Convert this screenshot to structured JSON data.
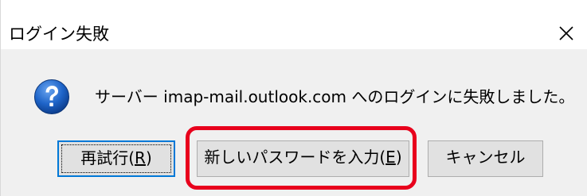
{
  "window": {
    "title": "ログイン失敗",
    "close_glyph": "✕"
  },
  "message": {
    "icon": "question-icon",
    "text": "サーバー imap-mail.outlook.com へのログインに失敗しました。"
  },
  "buttons": {
    "retry": {
      "label": "再試行(",
      "mnemonic": "R",
      "suffix": ")"
    },
    "new_password": {
      "label": "新しいパスワードを入力(",
      "mnemonic": "E",
      "suffix": ")"
    },
    "cancel": {
      "label": "キャンセル"
    }
  },
  "annotation": {
    "highlight_color": "#e8001c"
  },
  "colors": {
    "dialog_bg": "#f0f0f0",
    "titlebar_bg": "#ffffff",
    "button_bg": "#e1e1e1",
    "focus_border": "#0078d7",
    "icon_blue": "#1e64c8"
  }
}
